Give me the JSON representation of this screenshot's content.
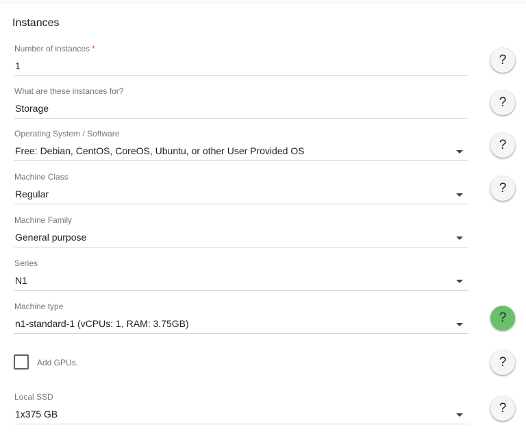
{
  "section": {
    "title": "Instances"
  },
  "fields": {
    "instances": {
      "label": "Number of instances",
      "required_mark": "*",
      "value": "1"
    },
    "purpose": {
      "label": "What are these instances for?",
      "value": "Storage"
    },
    "os": {
      "label": "Operating System / Software",
      "value": "Free: Debian, CentOS, CoreOS, Ubuntu, or other User Provided OS"
    },
    "machine_class": {
      "label": "Machine Class",
      "value": "Regular"
    },
    "machine_family": {
      "label": "Machine Family",
      "value": "General purpose"
    },
    "series": {
      "label": "Series",
      "value": "N1"
    },
    "machine_type": {
      "label": "Machine type",
      "value": "n1-standard-1 (vCPUs: 1, RAM: 3.75GB)"
    },
    "local_ssd": {
      "label": "Local SSD",
      "value": "1x375 GB"
    }
  },
  "gpus": {
    "label": "Add GPUs.",
    "checked": false
  },
  "help": {
    "glyph": "?",
    "icon": "help-icon",
    "active_color": "#6abf69"
  }
}
